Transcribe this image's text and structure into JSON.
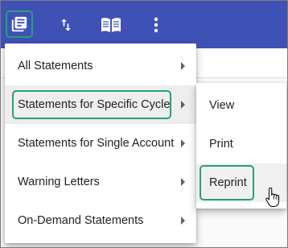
{
  "toolbar": {
    "buttons": [
      {
        "icon": "statements-icon"
      },
      {
        "icon": "sort-icon"
      },
      {
        "icon": "book-icon"
      },
      {
        "icon": "more-vert-icon"
      }
    ],
    "color": "#3f51b5"
  },
  "menu": {
    "items": [
      {
        "label": "All Statements"
      },
      {
        "label": "Statements for Specific Cycle"
      },
      {
        "label": "Statements for Single Account"
      },
      {
        "label": "Warning Letters"
      },
      {
        "label": "On-Demand Statements"
      }
    ],
    "active_item": "Statements for Specific Cycle"
  },
  "submenu": {
    "items": [
      {
        "label": "View"
      },
      {
        "label": "Print"
      },
      {
        "label": "Reprint"
      }
    ],
    "hovered_item": "Reprint"
  },
  "highlight_color": "#26a17a"
}
